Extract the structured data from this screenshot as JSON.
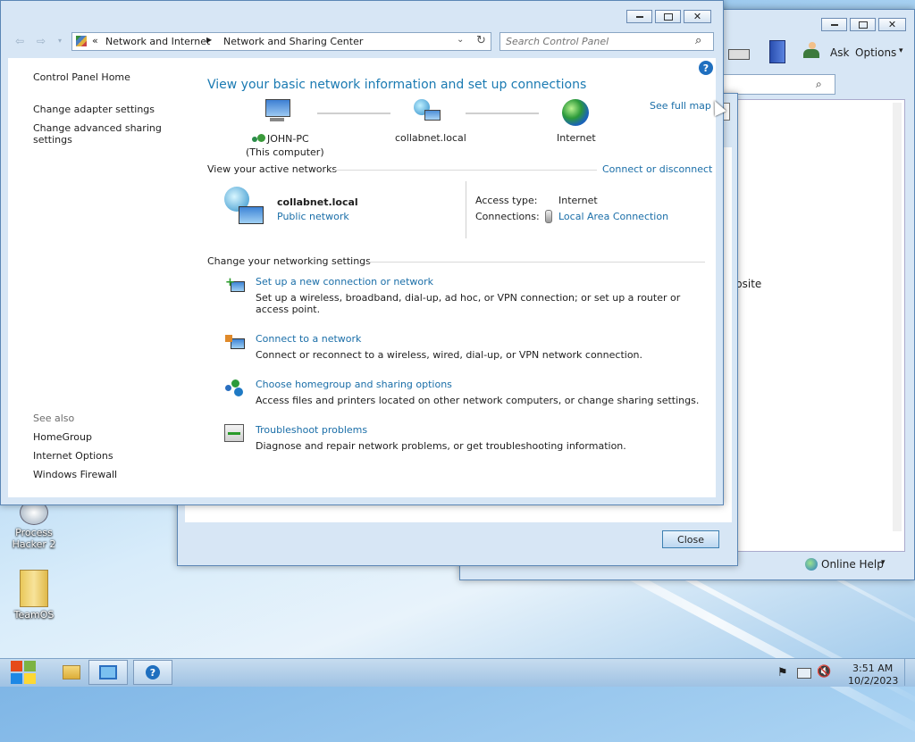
{
  "back_window_right": {
    "toolbar": {
      "ask": "Ask",
      "options": "Options"
    },
    "partial_text": "bsite",
    "online_help": "Online Help"
  },
  "back_window_mid": {
    "close_label": "Close"
  },
  "main_window": {
    "breadcrumb": {
      "root": "Network and Internet",
      "current": "Network and Sharing Center"
    },
    "search_placeholder": "Search Control Panel",
    "sidebar": {
      "home": "Control Panel Home",
      "items": [
        "Change adapter settings",
        "Change advanced sharing settings"
      ],
      "see_also_heading": "See also",
      "see_also": [
        "HomeGroup",
        "Internet Options",
        "Windows Firewall"
      ]
    },
    "heading": "View your basic network information and set up connections",
    "see_full_map": "See full map",
    "map": {
      "computer_name": "JOHN-PC",
      "computer_sub": "(This computer)",
      "network": "collabnet.local",
      "internet": "Internet"
    },
    "active_networks": {
      "heading": "View your active networks",
      "connect_link": "Connect or disconnect",
      "name": "collabnet.local",
      "type": "Public network",
      "access_label": "Access type:",
      "access_value": "Internet",
      "connections_label": "Connections:",
      "connections_value": "Local Area Connection"
    },
    "change_settings": {
      "heading": "Change your networking settings",
      "items": [
        {
          "title": "Set up a new connection or network",
          "desc": "Set up a wireless, broadband, dial-up, ad hoc, or VPN connection; or set up a router or access point."
        },
        {
          "title": "Connect to a network",
          "desc": "Connect or reconnect to a wireless, wired, dial-up, or VPN network connection."
        },
        {
          "title": "Choose homegroup and sharing options",
          "desc": "Access files and printers located on other network computers, or change sharing settings."
        },
        {
          "title": "Troubleshoot problems",
          "desc": "Diagnose and repair network problems, or get troubleshooting information."
        }
      ]
    }
  },
  "desktop_icons": [
    "Process Hacker 2",
    "TeamOS"
  ],
  "taskbar": {
    "time": "3:51 AM",
    "date": "10/2/2023"
  }
}
